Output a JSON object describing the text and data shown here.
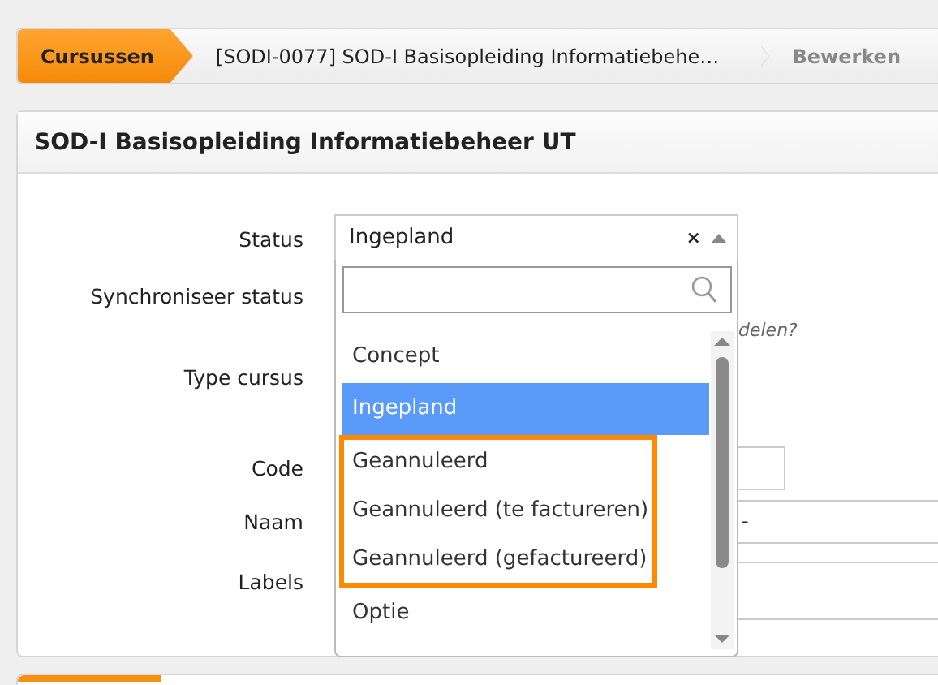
{
  "breadcrumb": [
    {
      "label": "Cursussen",
      "selected": true,
      "disabled": false
    },
    {
      "label": "[SODI-0077] SOD-I Basisopleiding Informatiebehe…",
      "selected": false,
      "disabled": false
    },
    {
      "label": "Bewerken",
      "selected": false,
      "disabled": true
    }
  ],
  "panel": {
    "title": "SOD-I Basisopleiding Informatiebeheer UT"
  },
  "form": {
    "fields": [
      {
        "label": "Status"
      },
      {
        "label": "Synchroniseer status",
        "hint": "delen?"
      },
      {
        "label": "Type cursus"
      },
      {
        "label": "Code"
      },
      {
        "label": "Naam",
        "value": "-"
      },
      {
        "label": "Labels"
      }
    ]
  },
  "status_select": {
    "value": "Ingepland",
    "clear": "×",
    "expanded": true,
    "options": [
      {
        "label": "Concept",
        "selected": false,
        "annotated": false
      },
      {
        "label": "Ingepland",
        "selected": true,
        "annotated": false
      },
      {
        "label": "Geannuleerd",
        "selected": false,
        "annotated": true
      },
      {
        "label": "Geannuleerd (te factureren)",
        "selected": false,
        "annotated": true
      },
      {
        "label": "Geannuleerd (gefactureerd)",
        "selected": false,
        "annotated": true
      },
      {
        "label": "Optie",
        "selected": false,
        "annotated": false
      }
    ]
  }
}
